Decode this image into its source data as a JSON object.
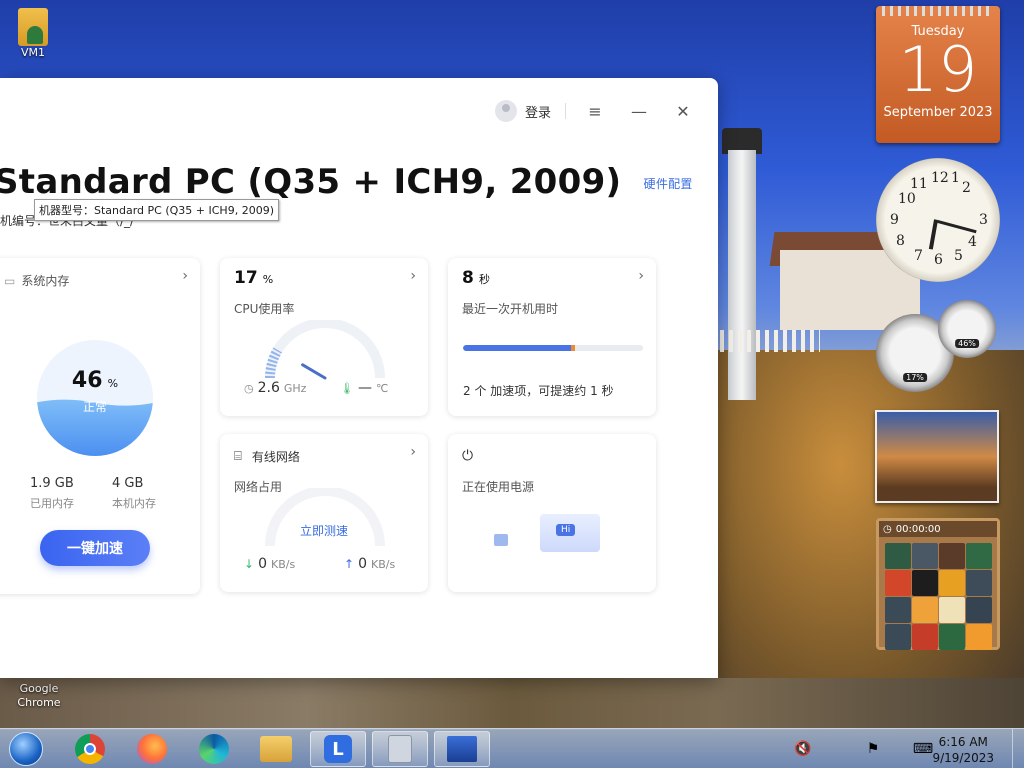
{
  "desktop": {
    "icons": [
      {
        "label": "VM1"
      },
      {
        "label": "Google Chrome"
      }
    ]
  },
  "gadgets": {
    "calendar": {
      "weekday": "Tuesday",
      "day": "19",
      "month_year": "September 2023"
    },
    "meter": {
      "cpu": "17%",
      "ram": "46%"
    },
    "puzzle": {
      "timer": "00:00:00"
    }
  },
  "app": {
    "login_label": "登录",
    "menu_icon": "≡",
    "min_icon": "—",
    "close_icon": "✕",
    "machine_title": "Standard PC (Q35 + ICH9, 2009)",
    "hardware_link": "硬件配置",
    "serial_text": "机编号：世未白文量（/_/",
    "tooltip": "机器型号：Standard PC (Q35 + ICH9, 2009)",
    "memory_card": {
      "title": "系统内存",
      "percent": "46",
      "percent_unit": "%",
      "status": "正常",
      "used_value": "1.9 GB",
      "used_label": "已用内存",
      "total_value": "4 GB",
      "total_label": "本机内存",
      "button": "一键加速",
      "fill_fraction": 0.46
    },
    "cpu_card": {
      "value": "17",
      "unit": "%",
      "label": "CPU使用率",
      "freq_value": "2.6",
      "freq_unit": "GHz",
      "temp_value": "—",
      "temp_unit": "℃",
      "fill_fraction": 0.17
    },
    "boot_card": {
      "value": "8",
      "unit": "秒",
      "label": "最近一次开机用时",
      "tip": "2 个 加速项，可提速约 1 秒",
      "bar_fraction": 0.6
    },
    "network_card": {
      "title": "有线网络",
      "label": "网络占用",
      "test_button": "立即测速",
      "down_value": "0",
      "down_unit": "KB/s",
      "up_value": "0",
      "up_unit": "KB/s"
    },
    "power_card": {
      "label": "正在使用电源",
      "hi_text": "Hi"
    }
  },
  "taskbar": {
    "time": "6:16 AM",
    "date": "9/19/2023"
  },
  "colors": {
    "accent": "#3a64f0",
    "boot_bar": "#4a74e6",
    "boot_bar_tip": "#f08a30",
    "calendar": "#d86b32"
  }
}
